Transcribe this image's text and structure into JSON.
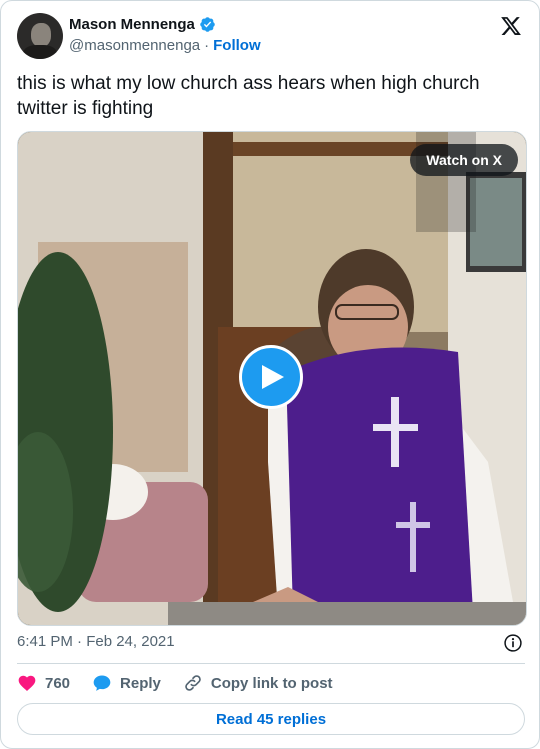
{
  "author": {
    "name": "Mason Mennenga",
    "handle": "@masonmennenga",
    "separator": "·",
    "follow_label": "Follow",
    "verified": true
  },
  "tweet": {
    "text": "this is what my low church ass hears when high church twitter is fighting"
  },
  "media": {
    "watch_label": "Watch on X",
    "play_icon": "play-icon"
  },
  "meta": {
    "time": "6:41 PM · Feb 24, 2021",
    "info_icon": "info-icon"
  },
  "actions": {
    "likes_count": "760",
    "reply_label": "Reply",
    "copy_label": "Copy link to post"
  },
  "footer": {
    "read_replies_label": "Read 45 replies"
  },
  "colors": {
    "accent": "#1d9bf0",
    "link": "#006fd6",
    "like": "#f91880",
    "muted": "#536471",
    "border": "#cfd9de"
  }
}
